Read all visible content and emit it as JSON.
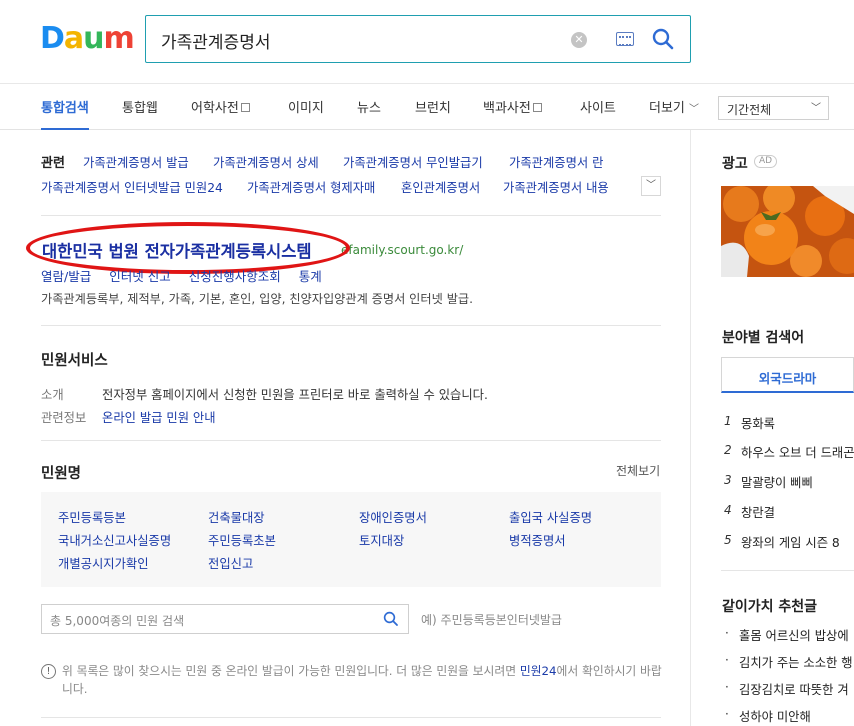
{
  "logo": {
    "letters": [
      "D",
      "a",
      "u",
      "m"
    ],
    "colors": [
      "#1a8cf0",
      "#f4b400",
      "#34b65a",
      "#ee4235"
    ]
  },
  "search": {
    "query": "가족관계증명서"
  },
  "tabs": [
    {
      "label": "통합검색",
      "active": true,
      "box": false
    },
    {
      "label": "통합웹",
      "active": false,
      "box": false
    },
    {
      "label": "어학사전",
      "active": false,
      "box": true
    },
    {
      "label": "이미지",
      "active": false,
      "box": false
    },
    {
      "label": "뉴스",
      "active": false,
      "box": false
    },
    {
      "label": "브런치",
      "active": false,
      "box": false
    },
    {
      "label": "백과사전",
      "active": false,
      "box": true
    },
    {
      "label": "사이트",
      "active": false,
      "box": false
    },
    {
      "label": "더보기",
      "active": false,
      "box": false
    }
  ],
  "period": {
    "label": "기간전체"
  },
  "related": {
    "label": "관련",
    "row1": [
      "가족관계증명서 발급",
      "가족관계증명서 상세",
      "가족관계증명서 무인발급기",
      "가족관계증명서 란"
    ],
    "row2": [
      "가족관계증명서 인터넷발급 민원24",
      "가족관계증명서 형제자매",
      "혼인관계증명서",
      "가족관계증명서 내용"
    ]
  },
  "result": {
    "title": "대한민국 법원 전자가족관계등록시스템",
    "url": "efamily.scourt.go.kr/",
    "sublinks": [
      "열람/발급",
      "인터넷 신고",
      "신청진행사항조회",
      "통계"
    ],
    "desc": "가족관계등록부, 제적부, 가족, 기본, 혼인, 입양, 친양자입양관계 증명서 인터넷 발급."
  },
  "civil": {
    "title": "민원서비스",
    "intro_label": "소개",
    "intro": "전자정부 홈페이지에서 신청한 민원을 프린터로 바로 출력하실 수 있습니다.",
    "info_label": "관련정보",
    "info": "온라인 발급 민원 안내",
    "list_title": "민원명",
    "view_all": "전체보기",
    "items": [
      [
        "주민등록등본",
        "건축물대장",
        "장애인증명서",
        "출입국 사실증명"
      ],
      [
        "국내거소신고사실증명",
        "주민등록초본",
        "토지대장",
        "병적증명서"
      ],
      [
        "개별공시지가확인",
        "전입신고"
      ]
    ],
    "search_placeholder": "총 5,000여종의 민원 검색",
    "example": "예) 주민등록등본인터넷발급",
    "notice_pre": "위 목록은 많이 찾으시는 민원 중 온라인 발급이 가능한 민원입니다. 더 많은 민원을 보시려면 ",
    "notice_link": "민원24",
    "notice_post": "에서 확인하시기 바랍니다."
  },
  "sidebar": {
    "ad_title": "광고",
    "ad_badge": "AD",
    "field_title": "분야별 검색어",
    "field_tab": "외국드라마",
    "ranks": [
      {
        "num": "1",
        "text": "몽화록"
      },
      {
        "num": "2",
        "text": "하우스 오브 더 드래곤"
      },
      {
        "num": "3",
        "text": "말괄량이 삐삐"
      },
      {
        "num": "4",
        "text": "창란결"
      },
      {
        "num": "5",
        "text": "왕좌의 게임 시즌 8"
      }
    ],
    "rec_title": "같이가치 추천글",
    "recs": [
      "홀몸 어르신의 밥상에",
      "김치가 주는 소소한 행",
      "김장김치로 따뜻한 겨",
      "성하야 미안해"
    ]
  }
}
